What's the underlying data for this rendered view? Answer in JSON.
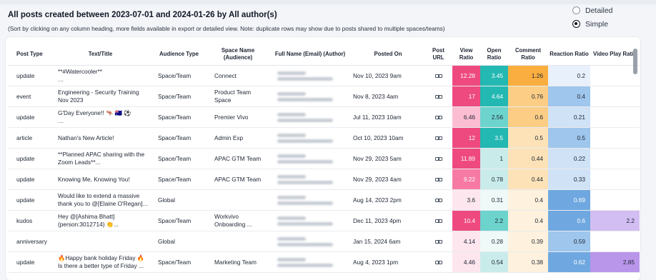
{
  "header": {
    "title": "All posts created between 2023-07-01 and 2024-01-26 by All author(s)",
    "subtitle": "(Sort by clicking on any column heading, more fields available in export or detailed view. Note: duplicate rows may show due to posts shared to multiple spaces/teams)"
  },
  "view_toggle": {
    "options": [
      {
        "label": "Detailed",
        "selected": false
      },
      {
        "label": "Simple",
        "selected": true
      }
    ]
  },
  "columns": [
    {
      "label": "Post Type"
    },
    {
      "label": "Text/Title"
    },
    {
      "label": "Audience Type"
    },
    {
      "label": "Space Name (Audience)"
    },
    {
      "label": "Full Name (Email) (Author)"
    },
    {
      "label": "Posted On"
    },
    {
      "label": "Post URL"
    },
    {
      "label": "View Ratio"
    },
    {
      "label": "Open Ratio"
    },
    {
      "label": "Comment Ratio"
    },
    {
      "label": "Reaction Ratio"
    },
    {
      "label": "Video Play Ratio"
    }
  ],
  "rows": [
    {
      "type": "update",
      "title": "**#Watercooler**\n…",
      "audience": "Space/Team",
      "space": "Connect",
      "posted": "Nov 10, 2023 9am",
      "view": "12.28",
      "open": "3.45",
      "comment": "1.26",
      "reaction": "0.2",
      "video": ""
    },
    {
      "type": "event",
      "title": "Engineering - Security Training Nov 2023",
      "audience": "Space/Team",
      "space": "Product Team Space",
      "posted": "Nov 8, 2023 4am",
      "view": "17",
      "open": "4.64",
      "comment": "0.76",
      "reaction": "0.4",
      "video": ""
    },
    {
      "type": "update",
      "title": "G'Day Everyone!! 🦘 🇦🇺 ⚽\n…",
      "audience": "Space/Team",
      "space": "Premier Vivo",
      "posted": "Jul 11, 2023 10am",
      "view": "6.46",
      "open": "2.56",
      "comment": "0.6",
      "reaction": "0.21",
      "video": ""
    },
    {
      "type": "article",
      "title": "Nathan's New Article!",
      "audience": "Space/Team",
      "space": "Admin Exp",
      "posted": "Oct 10, 2023 10am",
      "view": "12",
      "open": "3.5",
      "comment": "0.5",
      "reaction": "0.5",
      "video": ""
    },
    {
      "type": "update",
      "title": "**Planned APAC sharing with the Zoom Leads**...",
      "audience": "Space/Team",
      "space": "APAC GTM Team",
      "posted": "Nov 29, 2023 5am",
      "view": "11.89",
      "open": "1",
      "comment": "0.44",
      "reaction": "0.22",
      "video": ""
    },
    {
      "type": "update",
      "title": "Knowing Me, Knowing You!",
      "audience": "Space/Team",
      "space": "APAC GTM Team",
      "posted": "Nov 29, 2023 4am",
      "view": "9.22",
      "open": "0.78",
      "comment": "0.44",
      "reaction": "0.33",
      "video": ""
    },
    {
      "type": "update",
      "title": "Would like to extend a massive thank you to @[Elaine O'Regan]...",
      "audience": "Global",
      "space": "",
      "posted": "Aug 14, 2023 2pm",
      "view": "3.6",
      "open": "0.31",
      "comment": "0.4",
      "reaction": "0.69",
      "video": ""
    },
    {
      "type": "kudos",
      "title": "Hey @[Ashima Bhatt](person:3012714) 👏...",
      "audience": "Space/Team",
      "space": "Workvivo Onboarding ...",
      "posted": "Dec 11, 2023 4pm",
      "view": "10.4",
      "open": "2.2",
      "comment": "0.4",
      "reaction": "0.6",
      "video": "2.2"
    },
    {
      "type": "anniversary",
      "title": "",
      "audience": "Global",
      "space": "",
      "posted": "Jan 15, 2024 6am",
      "view": "4.14",
      "open": "0.28",
      "comment": "0.39",
      "reaction": "0.59",
      "video": ""
    },
    {
      "type": "update",
      "title": "🔥Happy bank holiday Friday 🔥\nIs there a better type of Friday ...",
      "audience": "Space/Team",
      "space": "Marketing Team",
      "posted": "Aug 4, 2023 1pm",
      "view": "4.46",
      "open": "0.54",
      "comment": "0.38",
      "reaction": "0.62",
      "video": "2.85"
    }
  ],
  "colors": {
    "view": [
      "#ee4a80",
      "#f67aa4",
      "#fbbdd2",
      "#fde6ee"
    ],
    "open": [
      "#24b8b2",
      "#6dd3cd",
      "#c9ecea",
      "#eef9f8"
    ],
    "comment": [
      "#f9ae3f",
      "#fbcd85",
      "#fde2b8",
      "#fef1dd"
    ],
    "reaction": [
      "#6fa8e0",
      "#9fc6ec",
      "#cfe2f6",
      "#e8f1fb"
    ],
    "video": [
      "#b996ea",
      "#d2bef2"
    ]
  }
}
